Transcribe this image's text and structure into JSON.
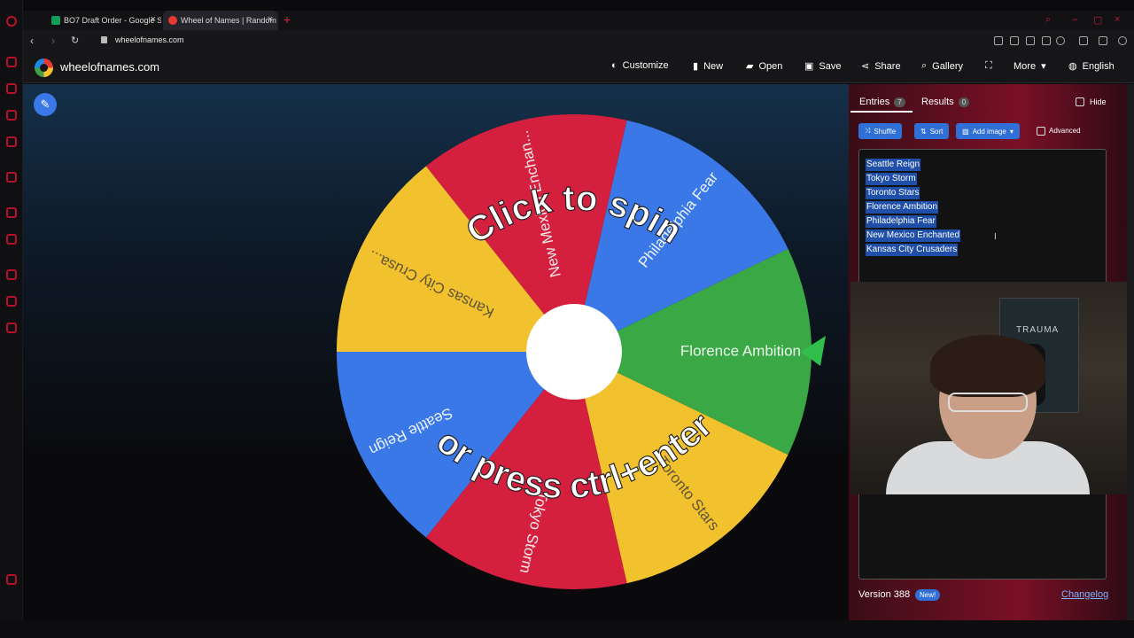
{
  "browser": {
    "tabs": [
      {
        "title": "BO7 Draft Order - Google S",
        "favicon_color": "#0f9d58",
        "active": false
      },
      {
        "title": "Wheel of Names | Random",
        "favicon_color": "#e53935",
        "active": true
      }
    ],
    "url": "wheelofnames.com",
    "accent": "#c2183a"
  },
  "site": {
    "title": "wheelofnames.com",
    "menu": [
      {
        "label": "Customize",
        "icon": "palette-icon",
        "glyph": "◐"
      },
      {
        "label": "New",
        "icon": "file-icon",
        "glyph": "▮"
      },
      {
        "label": "Open",
        "icon": "folder-icon",
        "glyph": "▰"
      },
      {
        "label": "Save",
        "icon": "save-icon",
        "glyph": "▣"
      },
      {
        "label": "Share",
        "icon": "share-icon",
        "glyph": "⋖"
      },
      {
        "label": "Gallery",
        "icon": "search-icon",
        "glyph": "⌕"
      },
      {
        "label": "",
        "icon": "fullscreen-icon",
        "glyph": "⛶"
      },
      {
        "label": "More",
        "icon": "chevron-down-icon",
        "glyph": "▾"
      },
      {
        "label": "English",
        "icon": "globe-icon",
        "glyph": "◍"
      }
    ]
  },
  "wheel": {
    "center_top_text": "Click to spin",
    "center_bottom_text": "or press ctrl+enter",
    "segments": [
      {
        "label": "Florence Ambition",
        "color": "#3aa845"
      },
      {
        "label": "Toronto Stars",
        "color": "#f2c12e"
      },
      {
        "label": "Tokyo Storm",
        "color": "#d4203e"
      },
      {
        "label": "Seattle Reign",
        "color": "#3b78e7"
      },
      {
        "label": "Kansas City Crusa...",
        "color": "#f2c12e"
      },
      {
        "label": "New Mexico Enchan...",
        "color": "#d4203e"
      },
      {
        "label": "Philadelphia Fear",
        "color": "#3b78e7"
      }
    ],
    "pointer_color": "#2fbf4a"
  },
  "panel": {
    "entries_tab": {
      "label": "Entries",
      "count": "7"
    },
    "results_tab": {
      "label": "Results",
      "count": "0"
    },
    "hide_label": "Hide",
    "buttons": [
      {
        "label": "Shuffle",
        "icon": "shuffle-icon",
        "glyph": "⤨"
      },
      {
        "label": "Sort",
        "icon": "sort-icon",
        "glyph": "⇅"
      },
      {
        "label": "Add image",
        "icon": "image-icon",
        "glyph": "▨"
      }
    ],
    "advanced_label": "Advanced",
    "entries": [
      "Seattle Reign",
      "Tokyo Storm",
      "Toronto Stars",
      "Florence Ambition",
      "Philadelphia Fear",
      "New Mexico Enchanted",
      "Kansas City Crusaders"
    ],
    "version": "Version 388",
    "new_badge": "New!",
    "changelog": "Changelog"
  },
  "webcam": {
    "poster_text": "TRAUMA"
  }
}
